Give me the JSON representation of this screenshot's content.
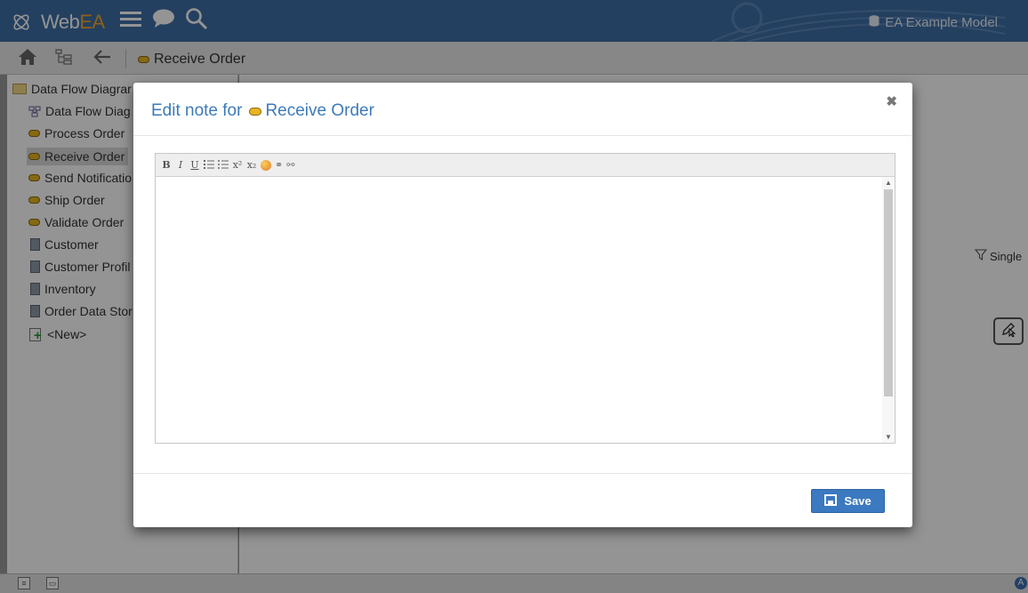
{
  "app": {
    "logo_prefix": "Web",
    "logo_suffix": "EA",
    "model_name": "EA Example Model",
    "colors": {
      "topbar": "#3f6fa5",
      "accent": "#3d7ab8",
      "logo_ea": "#f6a623"
    }
  },
  "toolbar": {
    "breadcrumb": "Receive Order",
    "icons": [
      "home-icon",
      "tree-view-icon",
      "back-arrow-icon"
    ]
  },
  "sidebar": {
    "items": [
      {
        "label": "Data Flow Diagrar",
        "icon": "folder-icon"
      },
      {
        "label": "Data Flow Diag",
        "icon": "diagram-icon"
      },
      {
        "label": "Process Order",
        "icon": "process-icon"
      },
      {
        "label": "Receive Order",
        "icon": "process-icon",
        "selected": true
      },
      {
        "label": "Send Notificatio",
        "icon": "process-icon"
      },
      {
        "label": "Ship Order",
        "icon": "process-icon"
      },
      {
        "label": "Validate Order",
        "icon": "process-icon"
      },
      {
        "label": "Customer",
        "icon": "datastore-icon"
      },
      {
        "label": "Customer Profil",
        "icon": "datastore-icon"
      },
      {
        "label": "Inventory",
        "icon": "datastore-icon"
      },
      {
        "label": "Order Data Stor",
        "icon": "datastore-icon"
      },
      {
        "label": "<New>",
        "icon": "new-icon"
      }
    ]
  },
  "right_pane": {
    "filter_label": "Single"
  },
  "modal": {
    "title_prefix": "Edit note for",
    "title_element": "Receive Order",
    "close_glyph": "✖",
    "editor": {
      "toolbar_buttons": [
        "B",
        "I",
        "U",
        "ordered-list",
        "unordered-list",
        "superscript",
        "subscript",
        "text-color",
        "link",
        "unlink"
      ],
      "content": ""
    },
    "save_label": "Save"
  }
}
